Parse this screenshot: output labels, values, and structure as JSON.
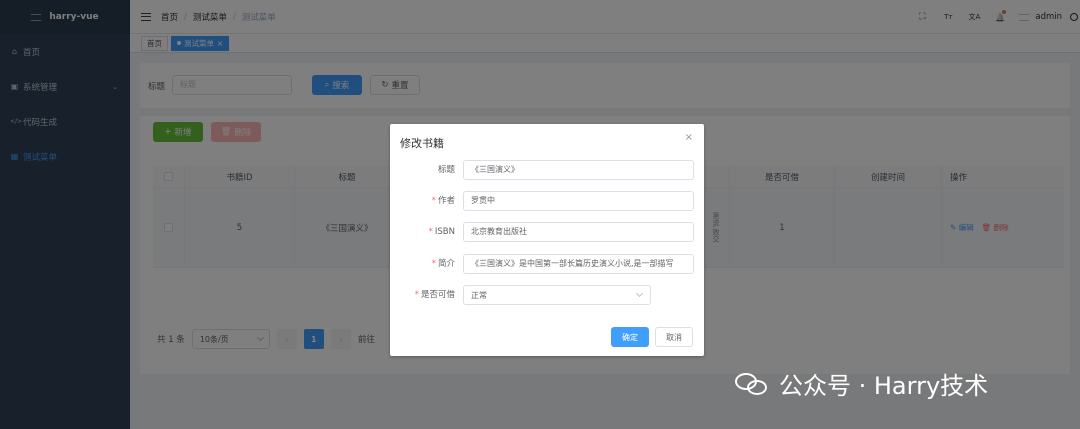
{
  "sidebar": {
    "title": "harry-vue",
    "items": [
      {
        "icon": "home-icon",
        "glyph": "⌂",
        "label": "首页"
      },
      {
        "icon": "monitor-icon",
        "glyph": "▣",
        "label": "系统管理"
      },
      {
        "icon": "code-icon",
        "glyph": "</>",
        "label": "代码生成"
      },
      {
        "icon": "grid-icon",
        "glyph": "▦",
        "label": "测试菜单"
      }
    ]
  },
  "navbar": {
    "breadcrumb": [
      "首页",
      "测试菜单",
      "测试菜单"
    ],
    "icons": {
      "fullscreen": "⛶",
      "font_size": "Tт",
      "translate": "文A",
      "bell": "🔔"
    },
    "user": "admin"
  },
  "tags": [
    {
      "label": "首页",
      "active": false
    },
    {
      "label": "测试菜单",
      "active": true,
      "close": "×"
    }
  ],
  "search": {
    "label": "标题",
    "placeholder": "标题",
    "search_button": "搜索",
    "reset_button": "重置"
  },
  "toolbar": {
    "add_button": "新增",
    "delete_button": "删除"
  },
  "table": {
    "columns": [
      "书籍ID",
      "标题",
      "是否可借",
      "创建时间",
      "操作"
    ],
    "rows": [
      {
        "id": "5",
        "title": "《三国演义》",
        "partial_intro": "第说,致交",
        "available": "1",
        "created": "",
        "edit": "编辑",
        "delete": "删除"
      }
    ]
  },
  "pagination": {
    "total": "共 1 条",
    "page_size": "10条/页",
    "current": "1",
    "goto": "前往"
  },
  "dialog": {
    "title": "修改书籍",
    "close": "×",
    "fields": [
      {
        "label": "标题",
        "required": false,
        "value": "《三国演义》"
      },
      {
        "label": "作者",
        "required": true,
        "value": "罗贯中"
      },
      {
        "label": "ISBN",
        "required": true,
        "value": "北京教育出版社"
      },
      {
        "label": "简介",
        "required": true,
        "value": "《三国演义》是中国第一部长篇历史演义小说,是一部描写"
      },
      {
        "label": "是否可借",
        "required": true,
        "value": "正常"
      }
    ],
    "confirm": "确定",
    "cancel": "取消"
  },
  "watermark": "公众号 · Harry技术",
  "colors": {
    "primary": "#409eff",
    "sidebar": "#304156",
    "danger": "#f56c6c",
    "success": "#67c23a"
  }
}
